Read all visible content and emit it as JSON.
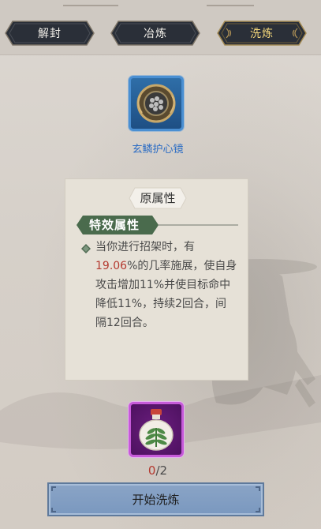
{
  "tabs": [
    {
      "label": "解封",
      "active": false
    },
    {
      "label": "冶炼",
      "active": false
    },
    {
      "label": "洗炼",
      "active": true
    }
  ],
  "equipment": {
    "name": "玄鳞护心镜",
    "icon": "scale-mirror-icon",
    "frame_color": "#3d82c9"
  },
  "attributes": {
    "section_title": "原属性",
    "special_title": "特效属性",
    "desc_prefix": "当你进行招架时，有",
    "desc_highlight": "19.06",
    "desc_suffix": "%的几率施展，使自身攻击增加11%并使目标命中降低11%，持续2回合，间隔12回合。",
    "highlight_color": "#b4392f"
  },
  "gem": {
    "icon": "herb-potion-icon",
    "frame_color": "#c65ad9",
    "current": "0",
    "total": "/2"
  },
  "start_button": {
    "label": "开始洗炼"
  }
}
